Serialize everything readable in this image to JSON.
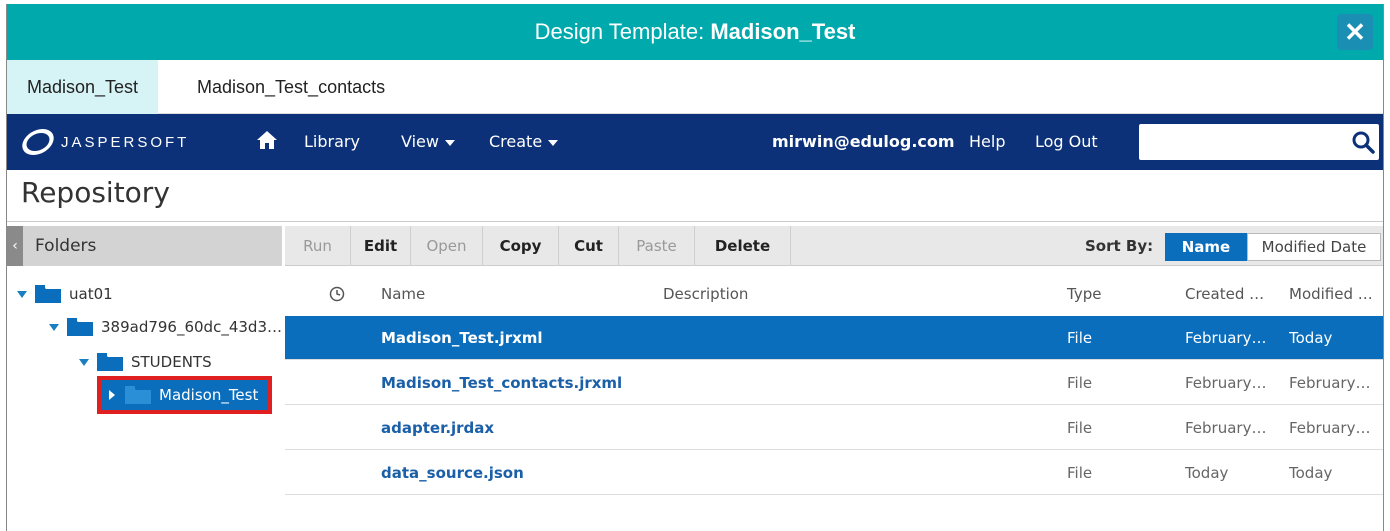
{
  "window": {
    "title_prefix": "Design Template: ",
    "title_name": "Madison_Test",
    "close_label": "✕"
  },
  "doc_tabs": [
    {
      "label": "Madison_Test"
    },
    {
      "label": "Madison_Test_contacts"
    }
  ],
  "nav": {
    "logo_text": "JASPERSOFT",
    "library": "Library",
    "view": "View",
    "create": "Create",
    "user": "mirwin@edulog.com",
    "help": "Help",
    "logout": "Log Out",
    "search_placeholder": ""
  },
  "page": {
    "title": "Repository"
  },
  "folders": {
    "header": "Folders",
    "collapse_icon": "‹",
    "tree": [
      {
        "label": "uat01"
      },
      {
        "label": "389ad796_60dc_43d3…"
      },
      {
        "label": "STUDENTS"
      },
      {
        "label": "Madison_Test"
      }
    ]
  },
  "toolbar": {
    "run": "Run",
    "edit": "Edit",
    "open": "Open",
    "copy": "Copy",
    "cut": "Cut",
    "paste": "Paste",
    "delete": "Delete",
    "sort_by": "Sort By:",
    "sort_name": "Name",
    "sort_modified": "Modified Date"
  },
  "table": {
    "headers": {
      "name": "Name",
      "description": "Description",
      "type": "Type",
      "created": "Created …",
      "modified": "Modified …"
    },
    "rows": [
      {
        "name": "Madison_Test.jrxml",
        "type": "File",
        "created": "February…",
        "modified": "Today"
      },
      {
        "name": "Madison_Test_contacts.jrxml",
        "type": "File",
        "created": "February…",
        "modified": "February…"
      },
      {
        "name": "adapter.jrdax",
        "type": "File",
        "created": "February…",
        "modified": "February…"
      },
      {
        "name": "data_source.json",
        "type": "File",
        "created": "Today",
        "modified": "Today"
      }
    ]
  },
  "colors": {
    "title_bar": "#00aaac",
    "nav_bar": "#0c3178",
    "accent": "#0a6ebd",
    "highlight": "#e02020"
  }
}
